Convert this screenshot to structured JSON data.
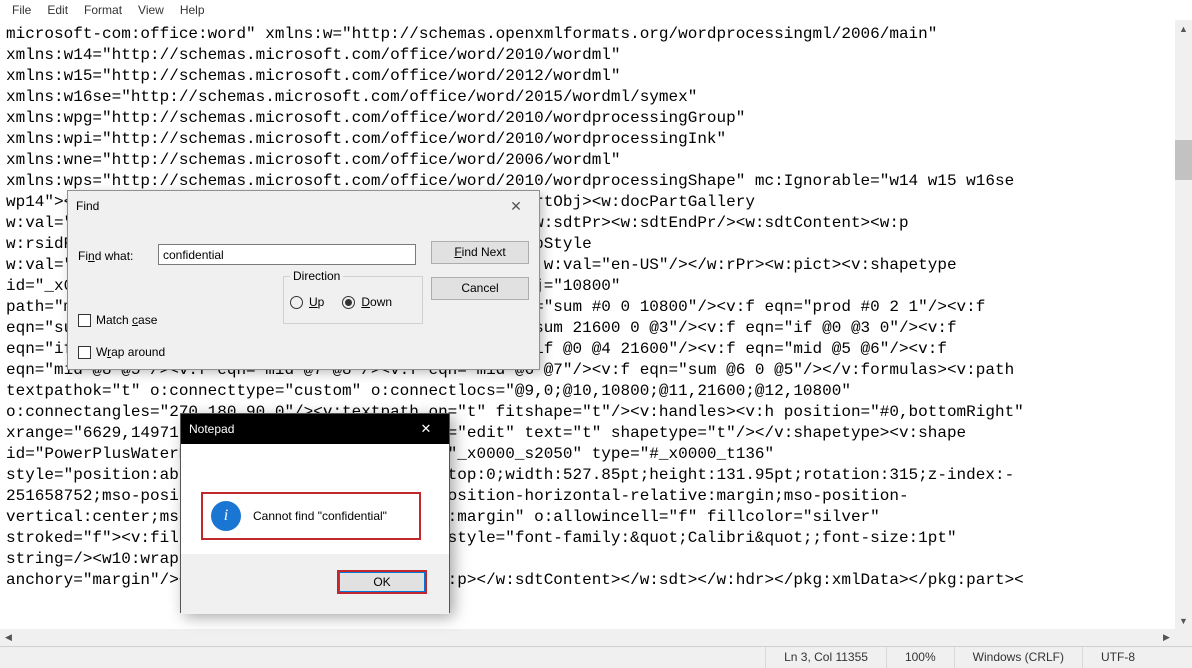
{
  "menu": {
    "file": "File",
    "edit": "Edit",
    "format": "Format",
    "view": "View",
    "help": "Help"
  },
  "editor_lines": [
    "microsoft-com:office:word\" xmlns:w=\"http://schemas.openxmlformats.org/wordprocessingml/2006/main\" ",
    "xmlns:w14=\"http://schemas.microsoft.com/office/word/2010/wordml\" ",
    "xmlns:w15=\"http://schemas.microsoft.com/office/word/2012/wordml\" ",
    "xmlns:w16se=\"http://schemas.microsoft.com/office/word/2015/wordml/symex\" ",
    "xmlns:wpg=\"http://schemas.microsoft.com/office/word/2010/wordprocessingGroup\" ",
    "xmlns:wpi=\"http://schemas.microsoft.com/office/word/2010/wordprocessingInk\" ",
    "xmlns:wne=\"http://schemas.microsoft.com/office/word/2006/wordml\" ",
    "xmlns:wps=\"http://schemas.microsoft.com/office/word/2010/wordprocessingShape\" mc:Ignorable=\"w14 w15 w16se ",
    "wp14\"><w:sdt><w:sdtPr><w:id w:val=\"148715948\"/><w:docPartObj><w:docPartGallery ",
    "w:val=\"Watermarks\"/><w:docPartUnique/></w:docPartObj></w:sdtPr><w:sdtEndPr/><w:sdtContent><w:p ",
    "w:rsidR=\"00F07A71\" w:rsidRDefault=\"00C45999\"><w:pPr><w:pStyle ",
    "w:val=\"Header\"/></w:pPr><w:r><w:rPr><w:noProof/><w:lang w:val=\"en-US\"/></w:rPr><w:pict><v:shapetype ",
    "id=\"_x0000_t136\" coordsize=\"21600,21600\" o:spt=\"136\" adj=\"10800\" ",
    "path=\"m@7,l@8,m@5,21600l@6,21600e\"><v:formulas><v:f eqn=\"sum #0 0 10800\"/><v:f eqn=\"prod #0 2 1\"/><v:f ",
    "eqn=\"sum 21600 0 @1\"/><v:f eqn=\"sum 0 0 @2\"/><v:f eqn=\"sum 21600 0 @3\"/><v:f eqn=\"if @0 @3 0\"/><v:f ",
    "eqn=\"if @0 21600 @1\"/><v:f eqn=\"if @0 0 @2\"/><v:f eqn=\"if @0 @4 21600\"/><v:f eqn=\"mid @5 @6\"/><v:f ",
    "eqn=\"mid @8 @5\"/><v:f eqn=\"mid @7 @8\"/><v:f eqn=\"mid @6 @7\"/><v:f eqn=\"sum @6 0 @5\"/></v:formulas><v:path ",
    "textpathok=\"t\" o:connecttype=\"custom\" o:connectlocs=\"@9,0;@10,10800;@11,21600;@12,10800\" ",
    "o:connectangles=\"270,180,90,0\"/><v:textpath on=\"t\" fitshape=\"t\"/><v:handles><v:h position=\"#0,bottomRight\" ",
    "xrange=\"6629,14971\"/></v:handles><o:lock v:ext=\"edit\" text=\"t\" shapetype=\"t\"/></v:shapetype><v:shape ",
    "id=\"PowerPlusWaterMarkObject357476642\" o:spid=\"_x0000_s2050\" type=\"#_x0000_t136\" ",
    "style=\"position:absolute;margin-left:0;margin-top:0;width:527.85pt;height:131.95pt;rotation:315;z-index:-",
    "251658752;mso-position-horizontal:center;mso-position-horizontal-relative:margin;mso-position-",
    "vertical:center;mso-position-vertical-relative:margin\" o:allowincell=\"f\" fillcolor=\"silver\" ",
    "stroked=\"f\"><v:fill opacity=\".5\"/><v:textpath style=\"font-family:&quot;Calibri&quot;;font-size:1pt\" ",
    "string=/><w10:wrap anchorx=\"margin\" ",
    "anchory=\"margin\"/></v:shape></w:pict></w:r></w:p></w:sdtContent></w:sdt></w:hdr></pkg:xmlData></pkg:part><"
  ],
  "find": {
    "title": "Find",
    "label_html": "Fi<u>n</u>d what:",
    "value": "confidential",
    "findnext_html": "<u>F</u>ind Next",
    "cancel": "Cancel",
    "direction": "Direction",
    "up_html": "<u>U</u>p",
    "down_html": "<u>D</u>own",
    "down_checked": true,
    "match_html": "Match <u>c</u>ase",
    "wrap_html": "W<u>r</u>ap around"
  },
  "msg": {
    "title": "Notepad",
    "text": "Cannot find \"confidential\"",
    "ok": "OK"
  },
  "status": {
    "pos": "Ln 3, Col 11355",
    "zoom": "100%",
    "eol": "Windows (CRLF)",
    "enc": "UTF-8"
  }
}
